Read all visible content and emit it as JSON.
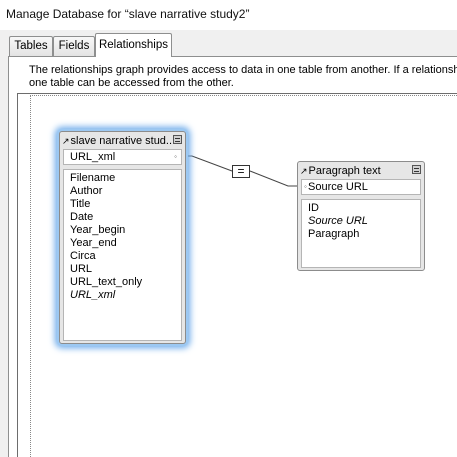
{
  "window": {
    "title": "Manage Database for “slave narrative study2”"
  },
  "tabs": [
    {
      "label": "Tables",
      "active": false
    },
    {
      "label": "Fields",
      "active": false
    },
    {
      "label": "Relationships",
      "active": true
    }
  ],
  "relationships": {
    "description_line1": "The relationships graph provides access to data in one table from another. If a relationsh",
    "description_line2": "one table can be accessed from the other.",
    "operator": "=",
    "tables": [
      {
        "name": "slave narrative stud...",
        "selected": true,
        "key_field": "URL_xml",
        "fields": [
          {
            "name": "Filename",
            "italic": false
          },
          {
            "name": "Author",
            "italic": false
          },
          {
            "name": "Title",
            "italic": false
          },
          {
            "name": "Date",
            "italic": false
          },
          {
            "name": "Year_begin",
            "italic": false
          },
          {
            "name": "Year_end",
            "italic": false
          },
          {
            "name": "Circa",
            "italic": false
          },
          {
            "name": "URL",
            "italic": false
          },
          {
            "name": "URL_text_only",
            "italic": false
          },
          {
            "name": "URL_xml",
            "italic": true
          }
        ]
      },
      {
        "name": "Paragraph text",
        "selected": false,
        "key_field": "Source URL",
        "fields": [
          {
            "name": "ID",
            "italic": false
          },
          {
            "name": "Source URL",
            "italic": true
          },
          {
            "name": "Paragraph",
            "italic": false
          }
        ]
      }
    ]
  },
  "colors": {
    "selection_glow": "#6aa9ea",
    "table_background": "#e6e6e6",
    "dialog_background": "#f0f0f0"
  }
}
